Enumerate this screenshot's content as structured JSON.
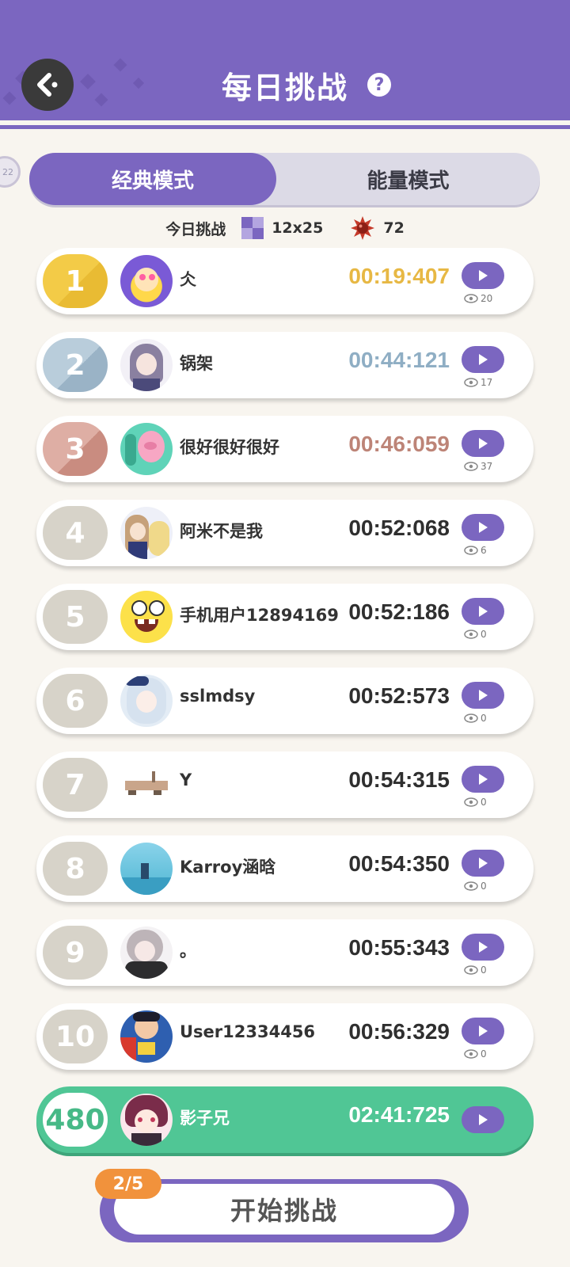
{
  "header": {
    "title": "每日挑战",
    "help_symbol": "?",
    "back_icon": "back-arrow-icon",
    "color": "#7b66c0"
  },
  "tabs": [
    {
      "label": "经典模式",
      "active": true
    },
    {
      "label": "能量模式",
      "active": false
    }
  ],
  "challenge_info": {
    "label": "今日挑战",
    "grid_size": "12x25",
    "mines": "72"
  },
  "leaderboard": [
    {
      "rank": "1",
      "name": "仌",
      "time": "00:19:407",
      "views": "20"
    },
    {
      "rank": "2",
      "name": "锅架",
      "time": "00:44:121",
      "views": "17"
    },
    {
      "rank": "3",
      "name": "很好很好很好",
      "time": "00:46:059",
      "views": "37"
    },
    {
      "rank": "4",
      "name": "阿米不是我",
      "time": "00:52:068",
      "views": "6"
    },
    {
      "rank": "5",
      "name": "手机用户12894169",
      "time": "00:52:186",
      "views": "0"
    },
    {
      "rank": "6",
      "name": "sslmdsy",
      "time": "00:52:573",
      "views": "0"
    },
    {
      "rank": "7",
      "name": "Y",
      "time": "00:54:315",
      "views": "0"
    },
    {
      "rank": "8",
      "name": "Karroy涵晗",
      "time": "00:54:350",
      "views": "0"
    },
    {
      "rank": "9",
      "name": "。",
      "time": "00:55:343",
      "views": "0"
    },
    {
      "rank": "10",
      "name": "User12334456",
      "time": "00:56:329",
      "views": "0"
    }
  ],
  "my_entry": {
    "rank": "480",
    "name": "影子兄",
    "time": "02:41:725"
  },
  "start": {
    "attempts": "2/5",
    "label": "开始挑战"
  },
  "colors": {
    "accent": "#7b66c0",
    "gold": "#e7b844",
    "silver": "#8faec4",
    "bronze": "#bd8477",
    "mine_row": "#50c695",
    "badge": "#f1923c"
  }
}
